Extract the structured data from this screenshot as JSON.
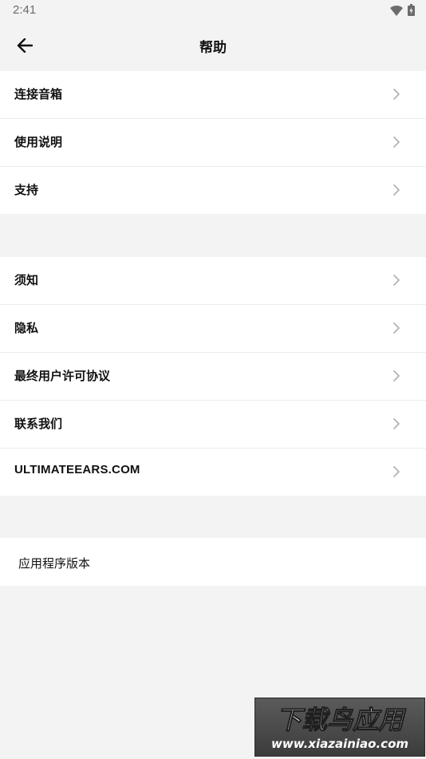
{
  "status_bar": {
    "time": "2:41"
  },
  "header": {
    "title": "帮助",
    "back_icon": "arrow-left-icon"
  },
  "group_1": {
    "items": [
      {
        "label": "连接音箱"
      },
      {
        "label": "使用说明"
      },
      {
        "label": "支持"
      }
    ]
  },
  "group_2": {
    "items": [
      {
        "label": "须知"
      },
      {
        "label": "隐私"
      },
      {
        "label": "最终用户许可协议"
      },
      {
        "label": "联系我们"
      },
      {
        "label": "ULTIMATEEARS.COM"
      }
    ]
  },
  "group_3": {
    "version_label": "应用程序版本"
  },
  "watermark": {
    "line1": "下载鸟应用",
    "line2": "www.xiazainiao.com"
  },
  "colors": {
    "background": "#f3f3f3",
    "card": "#ffffff",
    "divider": "#ececec",
    "chevron": "#b3b3b3",
    "status_text": "#6b6b6b"
  }
}
